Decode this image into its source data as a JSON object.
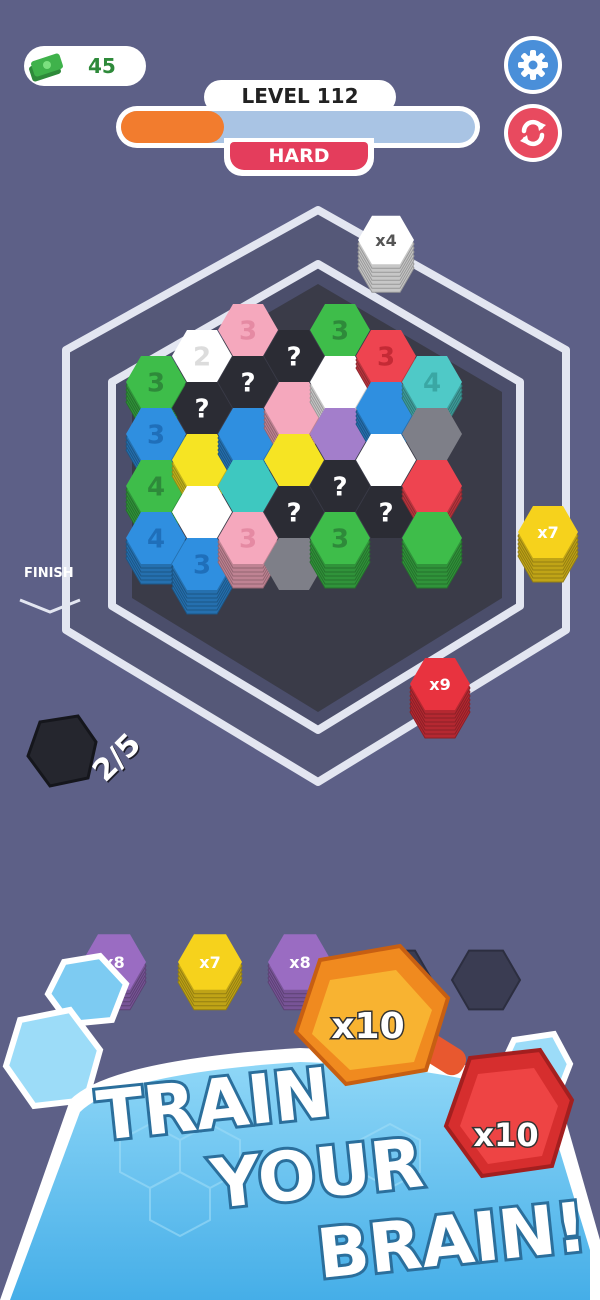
{
  "hud": {
    "cash": "45",
    "level_label": "LEVEL 112",
    "difficulty": "HARD",
    "progress": 0.29
  },
  "track": {
    "finish_label": "FINISH",
    "white_stack_label": "x4",
    "yellow_stack_label": "x7",
    "red_stack_label": "x9",
    "counter": "2/5"
  },
  "tray": {
    "slots": [
      {
        "label": "x8",
        "color": "#9a6cc2"
      },
      {
        "label": "x7",
        "color": "#f6d21c"
      },
      {
        "label": "x8",
        "color": "#9a6cc2"
      },
      {
        "label": "",
        "color": "empty"
      },
      {
        "label": "",
        "color": "empty"
      }
    ]
  },
  "promo": {
    "badge_orange": "x10",
    "badge_red": "x10",
    "line1": "TRAIN",
    "line2": "YOUR",
    "line3": "BRAIN!"
  },
  "board": {
    "unknown_mark": "?",
    "numbers": [
      "3",
      "2",
      "3",
      "3",
      "4",
      "3",
      "3",
      "4",
      "3",
      "3",
      "3",
      "4"
    ]
  },
  "colors": {
    "background": "#5d6087",
    "progress_fill": "#f27c2e",
    "hard_badge": "#e43d5c",
    "settings_button": "#4a8fd9",
    "restart_button": "#e84a5f"
  },
  "icons": [
    "cash-icon",
    "gear-icon",
    "restart-icon"
  ]
}
